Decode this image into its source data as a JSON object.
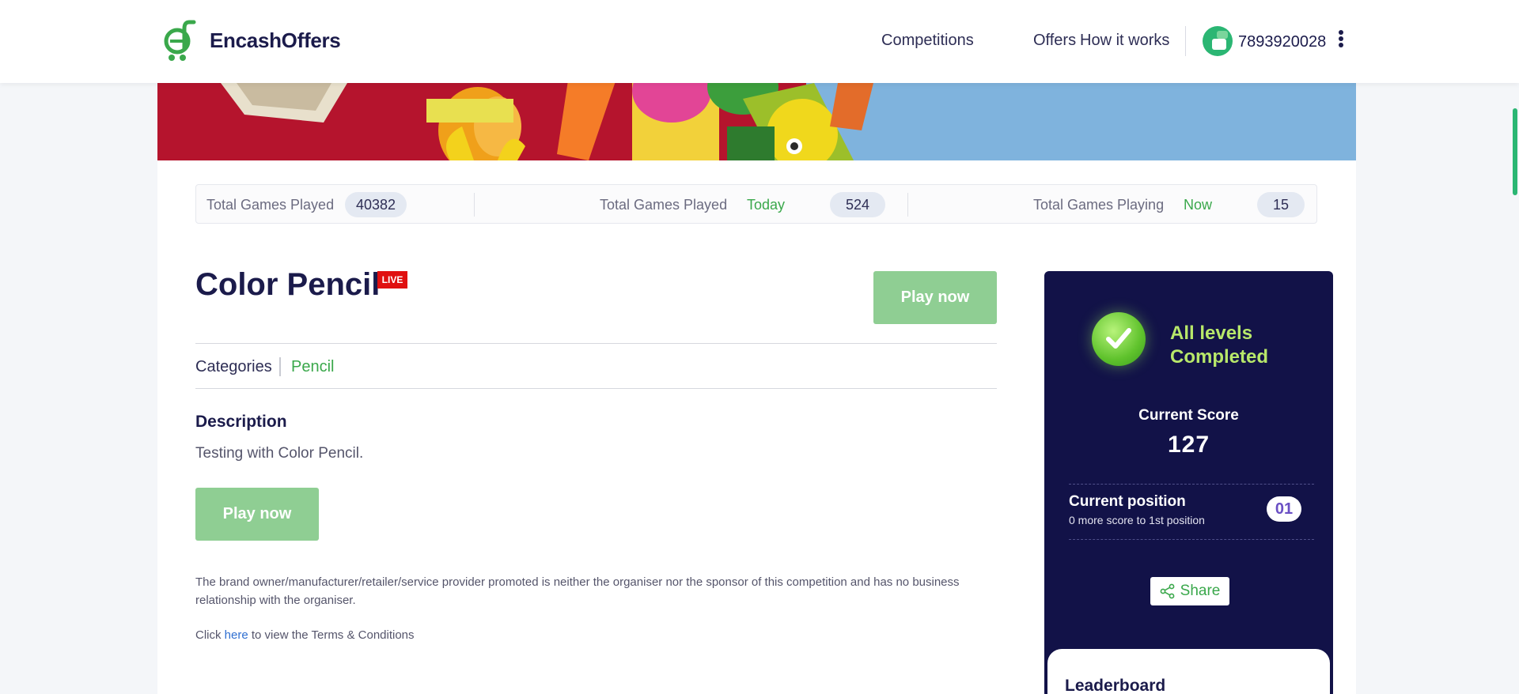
{
  "header": {
    "brand": "EncashOffers",
    "nav": [
      "Competitions",
      "Offers",
      "How it works"
    ],
    "phone": "7893920028"
  },
  "stats": {
    "total_label": "Total Games Played",
    "total_value": "40382",
    "today_label": "Total Games Played",
    "today_tag": "Today",
    "today_value": "524",
    "now_label": "Total Games Playing",
    "now_tag": "Now",
    "now_value": "15"
  },
  "game": {
    "title": "Color Pencil",
    "live_badge": "LIVE",
    "play_label": "Play now",
    "categories_label": "Categories",
    "category": "Pencil",
    "description_heading": "Description",
    "description": "Testing with Color Pencil.",
    "disclaimer": "The brand owner/manufacturer/retailer/service provider promoted is neither the organiser nor the sponsor of this competition and has no business relationship with the organiser.",
    "terms_prefix": "Click",
    "terms_link": "here",
    "terms_suffix": "to view the Terms & Conditions"
  },
  "panel": {
    "status": "All levels Completed",
    "score_label": "Current Score",
    "score": "127",
    "position_label": "Current position",
    "position_sub": "0 more score to 1st position",
    "position": "01",
    "share_label": "Share",
    "leaderboard_label": "Leaderboard"
  },
  "colors": {
    "brand_green": "#3aa84b",
    "button_green": "#8fce93",
    "panel_navy": "#121248",
    "live_red": "#e01010"
  }
}
